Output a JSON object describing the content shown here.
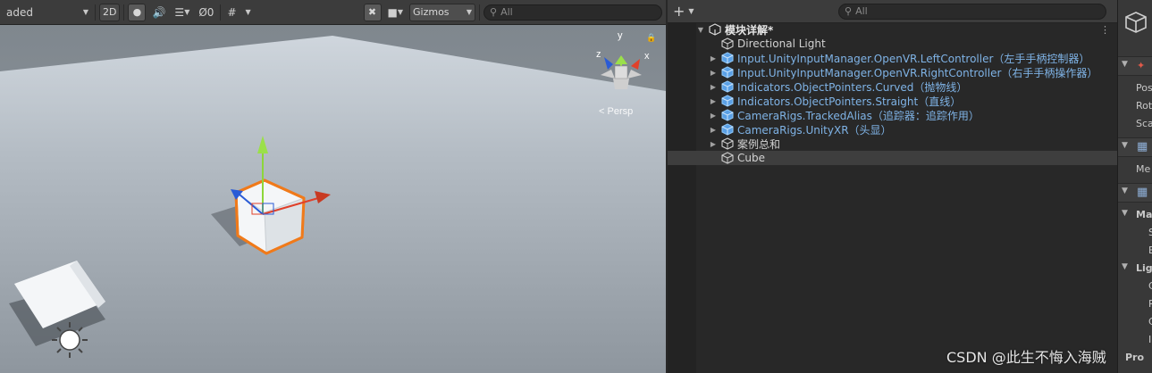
{
  "scene_toolbar": {
    "draw_mode_label": "aded",
    "two_d_label": "2D",
    "hidden_count": "0",
    "gizmos_label": "Gizmos",
    "search_placeholder": "All"
  },
  "scene": {
    "persp_label": "Persp",
    "axis_y": "y",
    "axis_x": "x",
    "axis_z": "z"
  },
  "hierarchy": {
    "search_placeholder": "All",
    "scene_name": "模块详解*",
    "items": [
      {
        "label": "Directional Light",
        "type": "plain",
        "has_children": false
      },
      {
        "label": "Input.UnityInputManager.OpenVR.LeftController（左手手柄控制器）",
        "type": "prefab",
        "has_children": true
      },
      {
        "label": "Input.UnityInputManager.OpenVR.RightController（右手手柄操作器）",
        "type": "prefab",
        "has_children": true
      },
      {
        "label": "Indicators.ObjectPointers.Curved（抛物线）",
        "type": "prefab",
        "has_children": true
      },
      {
        "label": "Indicators.ObjectPointers.Straight（直线）",
        "type": "prefab",
        "has_children": true
      },
      {
        "label": "CameraRigs.TrackedAlias（追踪器：追踪作用）",
        "type": "prefab",
        "has_children": true
      },
      {
        "label": "CameraRigs.UnityXR（头显）",
        "type": "prefab",
        "has_children": true
      },
      {
        "label": "案例总和",
        "type": "plain",
        "has_children": true
      },
      {
        "label": "Cube",
        "type": "plain",
        "has_children": false,
        "selected": true
      }
    ]
  },
  "inspector": {
    "row_pos": "Pos",
    "row_rot": "Rot",
    "row_sca": "Sca",
    "row_me": "Me",
    "row_ma": "Ma",
    "row_s": "S",
    "row_e": "E",
    "row_lig": "Lig",
    "row_c1": "C",
    "row_r": "R",
    "row_c2": "C",
    "row_i": "I",
    "row_pro": "Pro"
  },
  "watermark": "CSDN @此生不悔入海贼",
  "colors": {
    "prefab_text": "#7fb3e6",
    "selection_outline": "#f07a1a",
    "panel_bg": "#282828",
    "toolbar_bg": "#3c3c3c"
  }
}
